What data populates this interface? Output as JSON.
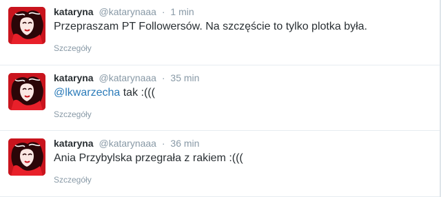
{
  "tweets": [
    {
      "fullname": "kataryna",
      "username": "@katarynaaa",
      "separator": "·",
      "time": "1 min",
      "text": "Przepraszam PT Followersów. Na szczęście to tylko plotka była.",
      "details_label": "Szczegóły",
      "avatar_icon": "user-avatar-icon"
    },
    {
      "fullname": "kataryna",
      "username": "@katarynaaa",
      "separator": "·",
      "time": "35 min",
      "mention": "@lkwarzecha",
      "text": " tak :(((",
      "details_label": "Szczegóły",
      "avatar_icon": "user-avatar-icon"
    },
    {
      "fullname": "kataryna",
      "username": "@katarynaaa",
      "separator": "·",
      "time": "36 min",
      "text": "Ania Przybylska przegrała z rakiem :(((",
      "details_label": "Szczegóły",
      "avatar_icon": "user-avatar-icon"
    }
  ],
  "colors": {
    "text": "#292f33",
    "muted": "#8899a6",
    "link": "#2b7bb9",
    "avatar_red": "#c9141d",
    "divider": "#e6ecf0"
  }
}
